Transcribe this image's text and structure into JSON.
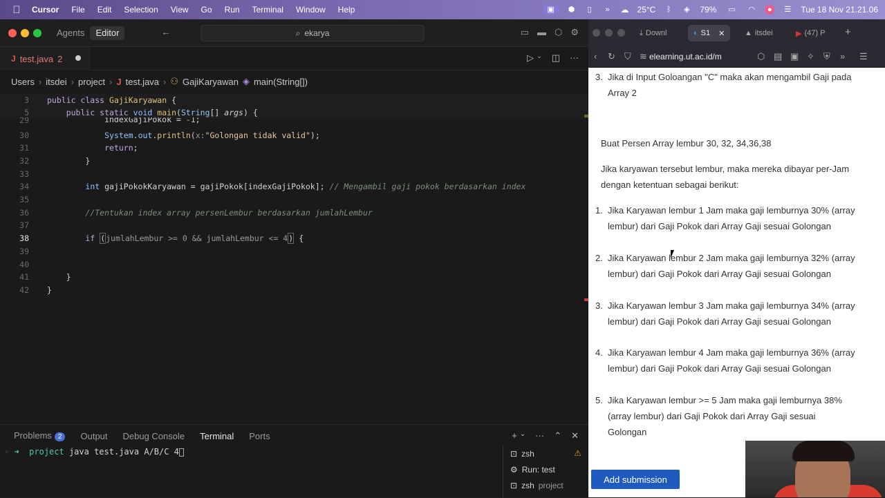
{
  "menubar": {
    "app": "Cursor",
    "items": [
      "File",
      "Edit",
      "Selection",
      "View",
      "Go",
      "Run",
      "Terminal",
      "Window",
      "Help"
    ],
    "weather": "25°C",
    "battery": "79%",
    "datetime": "Tue 18 Nov  21.21.06"
  },
  "editor": {
    "mode_tabs": [
      "Agents",
      "Editor"
    ],
    "active_mode": "Editor",
    "search_text": "ekarya",
    "tab": {
      "filename": "test.java",
      "problems": "2"
    },
    "breadcrumb": [
      "Users",
      "itsdei",
      "project",
      "test.java",
      "GajiKaryawan",
      "main(String[])"
    ],
    "code_lines": [
      {
        "n": "3",
        "text": "public class GajiKaryawan {"
      },
      {
        "n": "5",
        "text": "    public static void main(String[] args) {"
      },
      {
        "n": "29",
        "text": "            indexGajiPokok = -1;"
      },
      {
        "n": "30",
        "text": "            System.out.println(x:\"Golongan tidak valid\");"
      },
      {
        "n": "31",
        "text": "            return;"
      },
      {
        "n": "32",
        "text": "        }"
      },
      {
        "n": "33",
        "text": ""
      },
      {
        "n": "34",
        "text": "        int gajiPokokKaryawan = gajiPokok[indexGajiPokok]; // Mengambil gaji pokok berdasarkan index"
      },
      {
        "n": "35",
        "text": ""
      },
      {
        "n": "36",
        "text": "        //Tentukan index array persenLembur berdasarkan jumlahLembur"
      },
      {
        "n": "37",
        "text": ""
      },
      {
        "n": "38",
        "text": "        if (jumlahLembur >= 0 && jumlahLembur <= 4) {"
      },
      {
        "n": "39",
        "text": ""
      },
      {
        "n": "40",
        "text": ""
      },
      {
        "n": "41",
        "text": "    }"
      },
      {
        "n": "42",
        "text": "}"
      }
    ]
  },
  "panel": {
    "tabs": [
      "Problems",
      "Output",
      "Debug Console",
      "Terminal",
      "Ports"
    ],
    "problems_count": "2",
    "active": "Terminal",
    "terminal_line": "project java test.java A/B/C 4",
    "terminal_dir": "project",
    "terminal_cmd": " java test.java A/B/C 4",
    "terminals": [
      {
        "label": "zsh",
        "sub": ""
      },
      {
        "label": "Run: test",
        "sub": ""
      },
      {
        "label": "zsh",
        "sub": "project"
      }
    ]
  },
  "browser": {
    "tabs": [
      "Downl",
      "S1",
      "itsdei",
      "(47) P"
    ],
    "url": "elearning.ut.ac.id/m",
    "top_item": "3. Jika di Input Goloangan \"C\" maka akan mengambil Gaji pada Array 2",
    "top_item_num": "3.",
    "top_item_text": "Jika di Input Goloangan \"C\" maka akan mengambil Gaji pada Array 2",
    "para1": "Buat Persen Array lembur 30, 32, 34,36,38",
    "para2": "Jika karyawan tersebut lembur, maka mereka dibayar per-Jam dengan ketentuan sebagai berikut:",
    "list": [
      "Jika Karyawan lembur 1 Jam maka gaji lemburnya 30% (array lembur) dari Gaji Pokok dari Array Gaji sesuai Golongan",
      "Jika Karyawan lembur 2 Jam maka gaji lemburnya 32% (array lembur) dari Gaji Pokok dari Array Gaji sesuai Golongan",
      "Jika Karyawan lembur 3 Jam maka gaji lemburnya 34% (array lembur) dari Gaji Pokok dari Array Gaji sesuai Golongan",
      "Jika Karyawan lembur 4 Jam maka gaji lemburnya 36% (array lembur) dari Gaji Pokok dari Array Gaji sesuai Golongan",
      "Jika Karyawan lembur >= 5 Jam maka gaji lemburnya 38% (array lembur) dari Gaji Pokok dari Array Gaji sesuai Golongan"
    ],
    "submit": "Add submission"
  }
}
